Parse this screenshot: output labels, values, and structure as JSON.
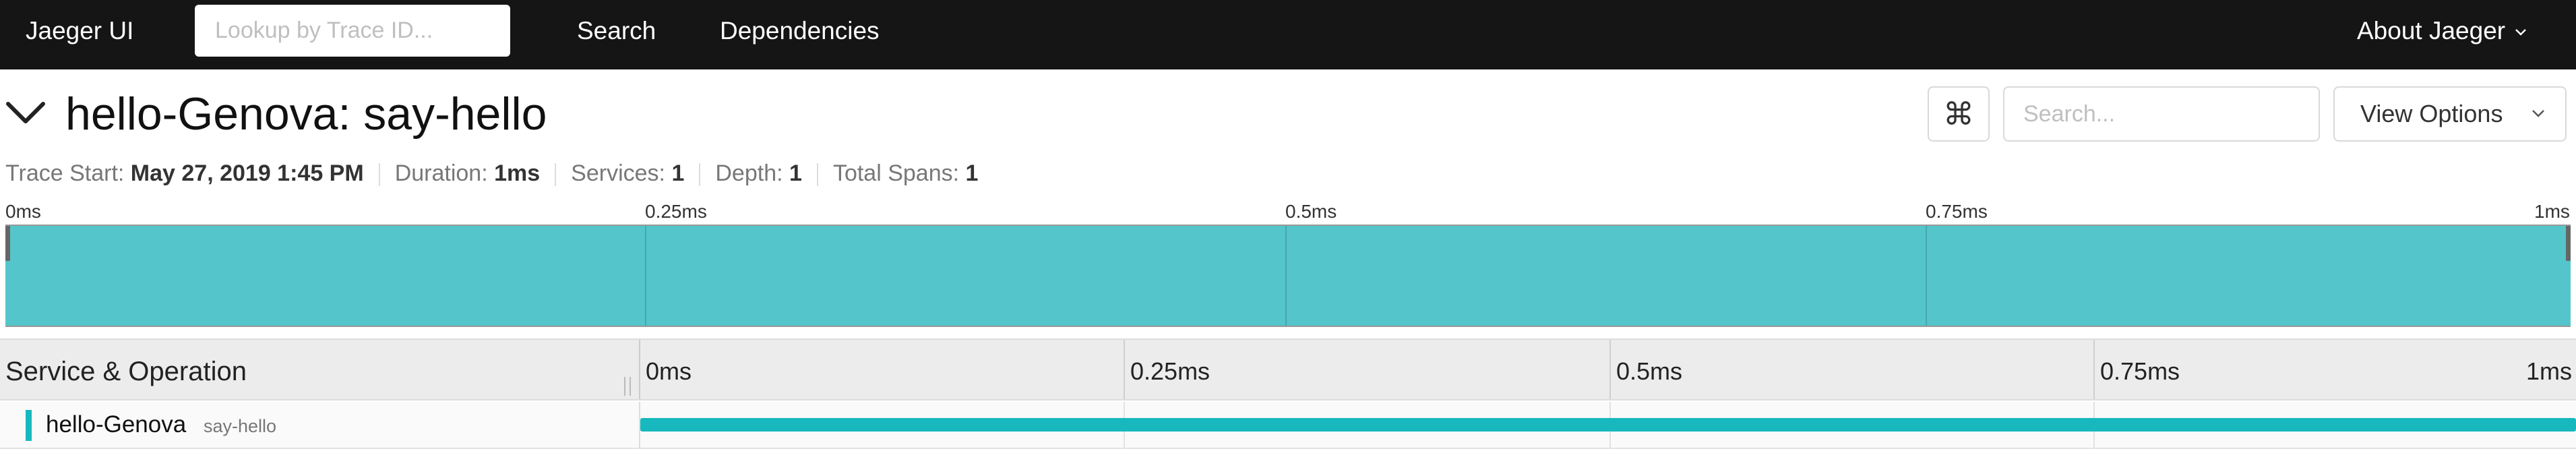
{
  "nav": {
    "brand": "Jaeger UI",
    "lookup_placeholder": "Lookup by Trace ID...",
    "links": [
      "Search",
      "Dependencies"
    ],
    "about": "About Jaeger",
    "about_icon": "chevron-down-icon"
  },
  "trace": {
    "collapse_icon": "chevron-down-icon",
    "title": "hello-Genova: say-hello",
    "keyboard_icon": "command-key-icon",
    "keyboard_glyph": "⌘",
    "search_placeholder": "Search...",
    "view_options": "View Options",
    "meta": [
      {
        "label": "Trace Start:",
        "value": "May 27, 2019 1:45 PM"
      },
      {
        "label": "Duration:",
        "value": "1ms"
      },
      {
        "label": "Services:",
        "value": "1"
      },
      {
        "label": "Depth:",
        "value": "1"
      },
      {
        "label": "Total Spans:",
        "value": "1"
      }
    ]
  },
  "minimap": {
    "ticks": [
      "0ms",
      "0.25ms",
      "0.5ms",
      "0.75ms",
      "1ms"
    ],
    "color": "#54c5cb"
  },
  "timeline": {
    "header": "Service & Operation",
    "ticks": [
      "0ms",
      "0.25ms",
      "0.5ms",
      "0.75ms",
      "1ms"
    ]
  },
  "spans": [
    {
      "service": "hello-Genova",
      "operation": "say-hello",
      "start_fraction": 0.0,
      "duration_fraction": 1.0,
      "color": "#17b8be"
    }
  ]
}
